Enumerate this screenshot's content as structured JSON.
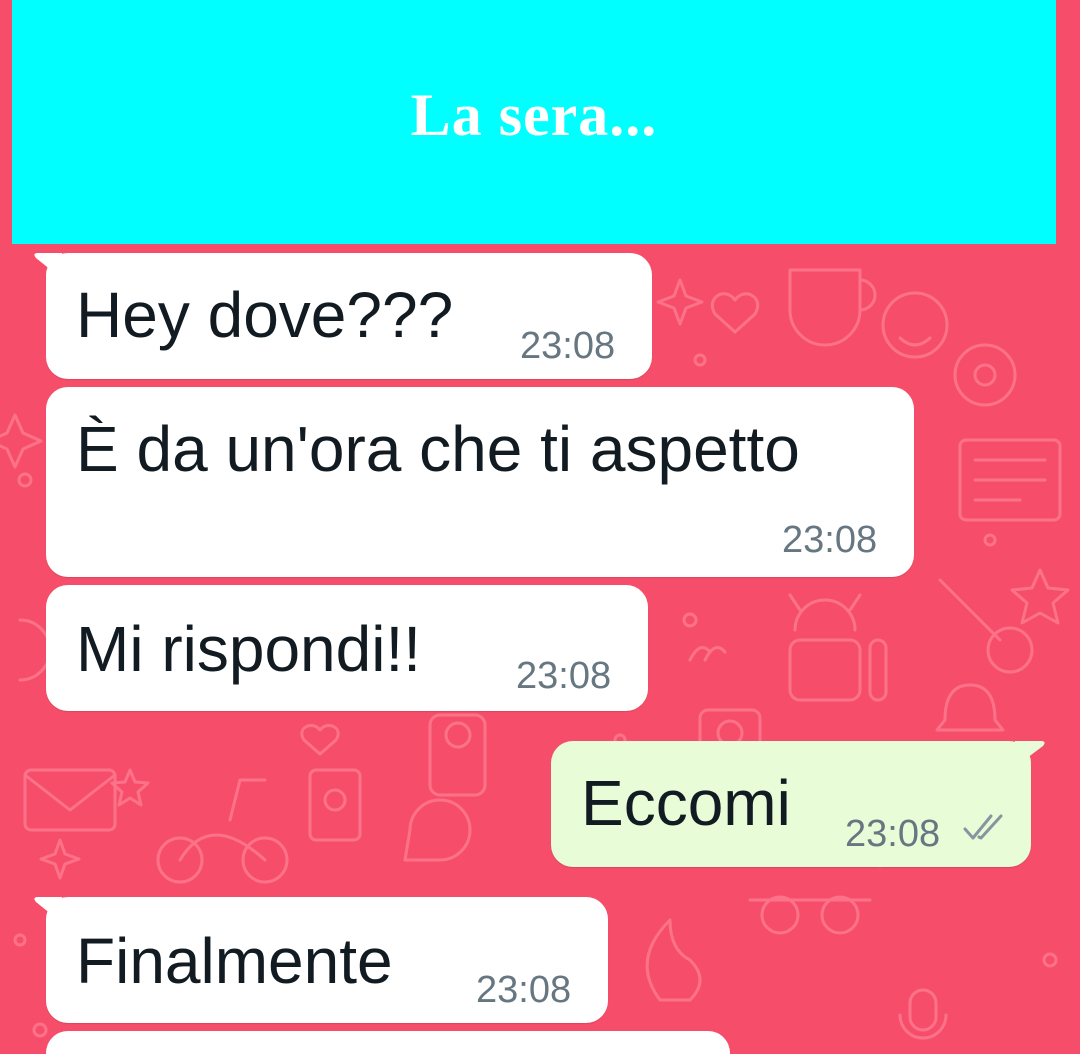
{
  "header": {
    "title": "La sera..."
  },
  "colors": {
    "wallpaper": "#f64e6a",
    "banner": "#00ffff",
    "incoming_bubble": "#ffffff",
    "outgoing_bubble": "#e7fcd7",
    "text": "#111b21",
    "timestamp": "#667781"
  },
  "messages": [
    {
      "direction": "incoming",
      "text": "Hey dove???",
      "time": "23:08"
    },
    {
      "direction": "incoming",
      "text": "È da un'ora che ti aspetto",
      "time": "23:08"
    },
    {
      "direction": "incoming",
      "text": "Mi rispondi!!",
      "time": "23:08"
    },
    {
      "direction": "outgoing",
      "text": "Eccomi",
      "time": "23:08",
      "status_icon": "double-check-icon"
    },
    {
      "direction": "incoming",
      "text": "Finalmente",
      "time": "23:08"
    }
  ]
}
